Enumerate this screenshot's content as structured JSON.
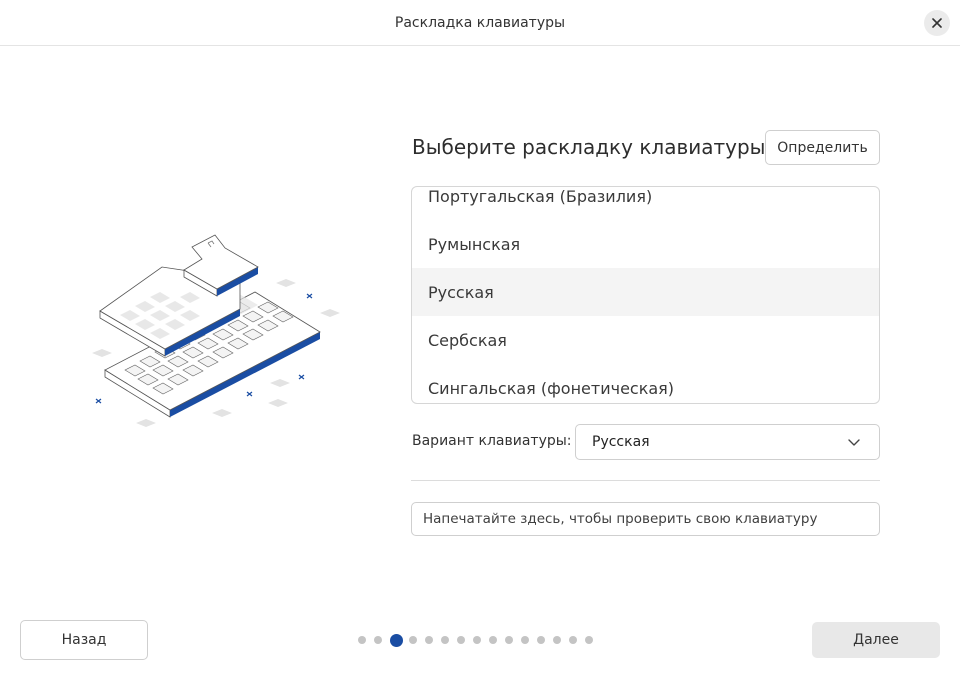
{
  "window": {
    "title": "Раскладка клавиатуры",
    "close_icon": "close-icon"
  },
  "main": {
    "heading": "Выберите раскладку клавиатуры",
    "detect_button": "Определить",
    "layouts": [
      {
        "label": "Португальская (Бразилия)",
        "selected": false
      },
      {
        "label": "Румынская",
        "selected": false
      },
      {
        "label": "Русская",
        "selected": true
      },
      {
        "label": "Сербская",
        "selected": false
      },
      {
        "label": "Сингальская (фонетическая)",
        "selected": false
      }
    ],
    "variant_label": "Вариант клавиатуры:",
    "variant_value": "Русская",
    "test_placeholder": "Напечатайте здесь, чтобы проверить свою клавиатуру"
  },
  "footer": {
    "back_button": "Назад",
    "next_button": "Далее",
    "pages_total": 15,
    "current_page": 3
  },
  "colors": {
    "accent": "#1a4da3",
    "selected_row": "#f4f4f4",
    "border": "#d6d6d6"
  }
}
